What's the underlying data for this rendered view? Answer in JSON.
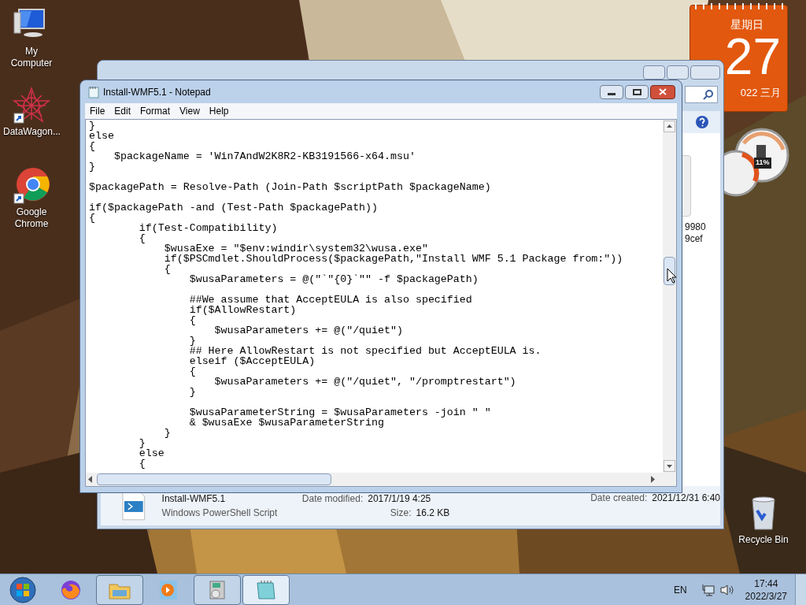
{
  "desktop_icons": [
    {
      "kind": "computer",
      "label": "My Computer"
    },
    {
      "kind": "star",
      "label": "DataWagon..."
    },
    {
      "kind": "chrome",
      "label": "Google Chrome"
    },
    {
      "kind": "bin",
      "label": "Recycle Bin"
    }
  ],
  "calendar_gadget": {
    "weekday": "星期日",
    "day": "27",
    "month_year": "022 三月"
  },
  "cpu_gadget": {
    "reading": "11%"
  },
  "explorer_window": {
    "file_item": {
      "line_1": "9980",
      "line_2": "9cef"
    },
    "details": {
      "name": "Install-WMF5.1",
      "type": "Windows PowerShell Script",
      "date_modified_label": "Date modified:",
      "date_modified": "2017/1/19 4:25",
      "size_label": "Size:",
      "size": "16.2 KB",
      "date_created_label": "Date created:",
      "date_created": "2021/12/31 6:40"
    }
  },
  "notepad": {
    "title": "Install-WMF5.1 - Notepad",
    "menu": [
      "File",
      "Edit",
      "Format",
      "View",
      "Help"
    ],
    "content": "}\nelse\n{\n    $packageName = 'Win7AndW2K8R2-KB3191566-x64.msu'\n}\n\n$packagePath = Resolve-Path (Join-Path $scriptPath $packageName)\n\nif($packagePath -and (Test-Path $packagePath))\n{\n        if(Test-Compatibility)\n        {\n            $wusaExe = \"$env:windir\\system32\\wusa.exe\"\n            if($PSCmdlet.ShouldProcess($packagePath,\"Install WMF 5.1 Package from:\"))\n            {\n                $wusaParameters = @(\"`\"{0}`\"\" -f $packagePath)\n\n                ##We assume that AcceptEULA is also specified\n                if($AllowRestart)\n                {\n                    $wusaParameters += @(\"/quiet\")\n                }\n                ## Here AllowRestart is not specified but AcceptEULA is.\n                elseif ($AcceptEULA)\n                {\n                    $wusaParameters += @(\"/quiet\", \"/promptrestart\")\n                }\n\n                $wusaParameterString = $wusaParameters -join \" \"\n                & $wusaExe $wusaParameterString\n            }\n        }\n        else\n        {"
  },
  "taskbar": {
    "items": [
      {
        "kind": "firefox",
        "running": false,
        "selected": false
      },
      {
        "kind": "explorer",
        "running": true,
        "selected": false
      },
      {
        "kind": "media",
        "running": false,
        "selected": false
      },
      {
        "kind": "installer",
        "running": true,
        "selected": false
      },
      {
        "kind": "notepad",
        "running": true,
        "selected": true
      }
    ],
    "language": "EN",
    "time": "17:44",
    "date": "2022/3/27"
  }
}
